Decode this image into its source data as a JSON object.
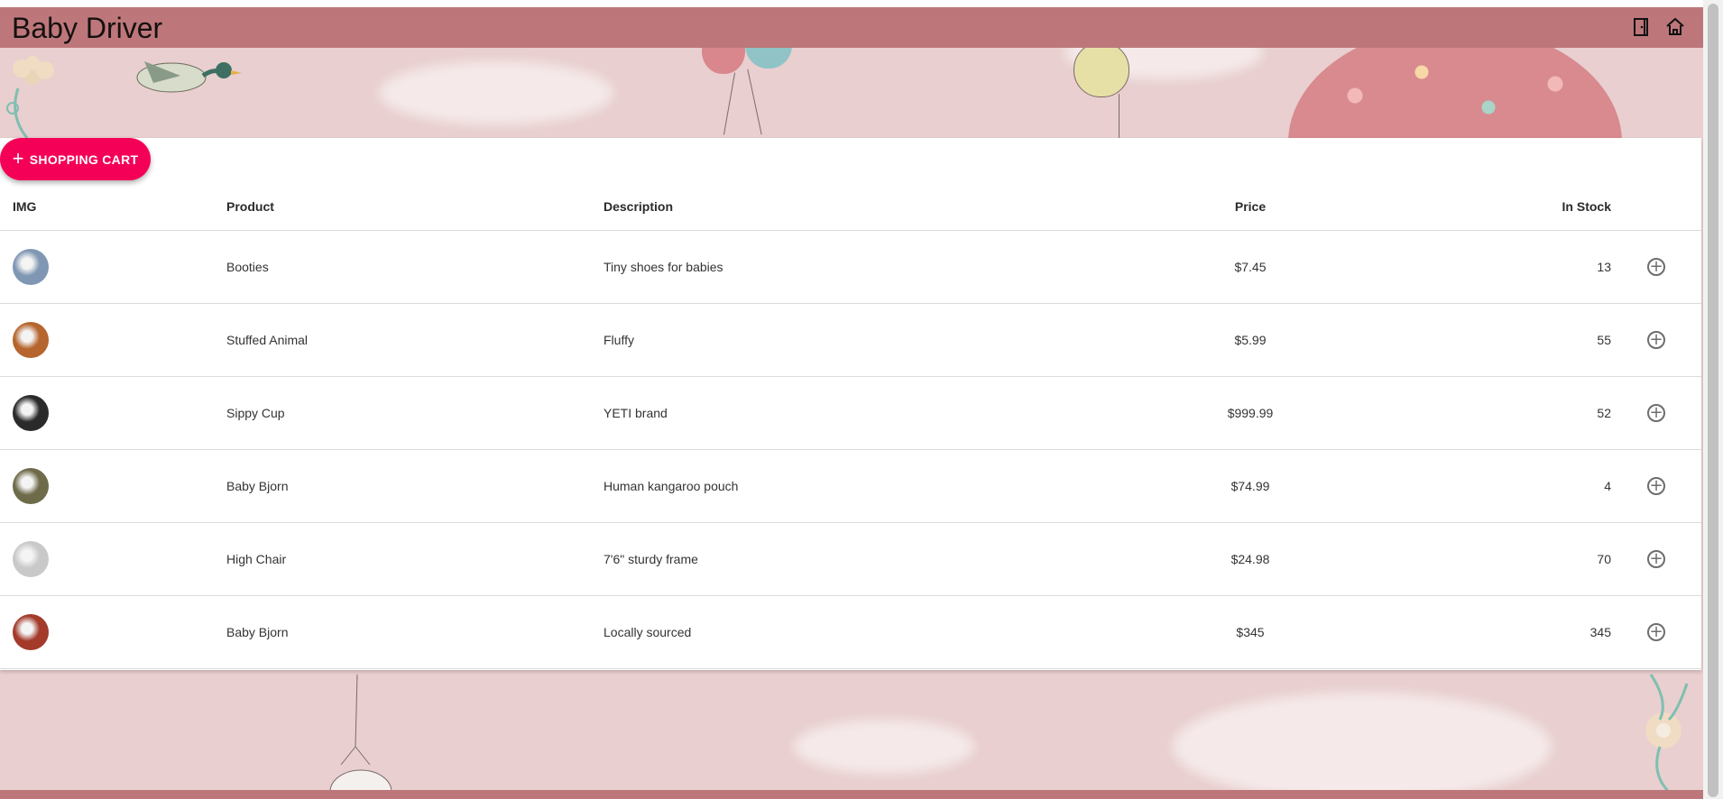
{
  "header": {
    "title": "Baby Driver",
    "icons": [
      "door-exit-icon",
      "home-icon"
    ]
  },
  "cart_button": {
    "label": "SHOPPING CART",
    "icon": "plus-icon"
  },
  "table": {
    "columns": [
      "IMG",
      "Product",
      "Description",
      "Price",
      "In Stock"
    ],
    "rows": [
      {
        "product": "Booties",
        "description": "Tiny shoes for babies",
        "price": "$7.45",
        "stock": "13",
        "thumb_color": "#7f97b3"
      },
      {
        "product": "Stuffed Animal",
        "description": "Fluffy",
        "price": "$5.99",
        "stock": "55",
        "thumb_color": "#b5652d"
      },
      {
        "product": "Sippy Cup",
        "description": "YETI brand",
        "price": "$999.99",
        "stock": "52",
        "thumb_color": "#2a2a2a"
      },
      {
        "product": "Baby Bjorn",
        "description": "Human kangaroo pouch",
        "price": "$74.99",
        "stock": "4",
        "thumb_color": "#6e6b4a"
      },
      {
        "product": "High Chair",
        "description": "7'6\" sturdy frame",
        "price": "$24.98",
        "stock": "70",
        "thumb_color": "#c9c9c9"
      },
      {
        "product": "Baby Bjorn",
        "description": "Locally sourced",
        "price": "$345",
        "stock": "345",
        "thumb_color": "#a33a2a"
      }
    ]
  },
  "colors": {
    "app_bar": "#bd777a",
    "accent": "#f50057",
    "wallpaper": "#e9cfcf"
  }
}
